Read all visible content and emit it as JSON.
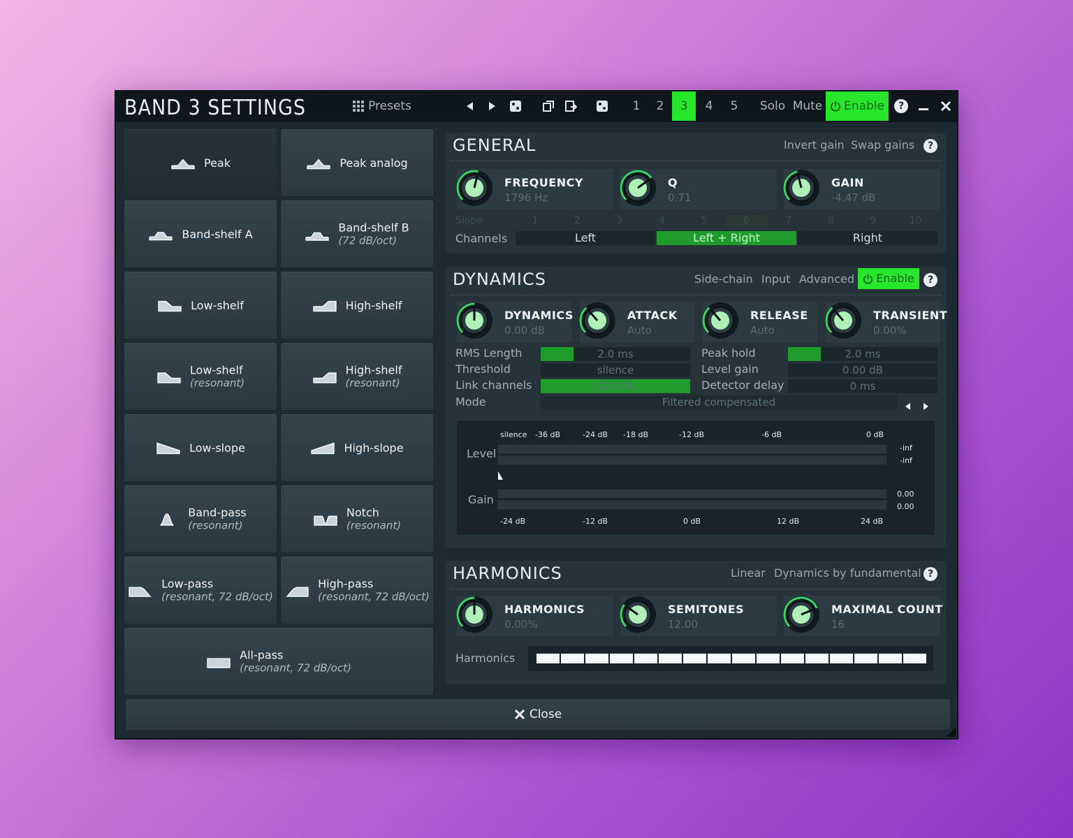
{
  "window": {
    "title": "BAND 3 SETTINGS",
    "presets_label": "Presets",
    "bands": [
      "1",
      "2",
      "3",
      "4",
      "5"
    ],
    "active_band": "3",
    "solo": "Solo",
    "mute": "Mute",
    "enable": "Enable",
    "accent_color": "#27e62b"
  },
  "filter_types": [
    {
      "label": "Peak",
      "sub": "",
      "icon": "peak-icon",
      "selected": true
    },
    {
      "label": "Peak analog",
      "sub": "",
      "icon": "peak-analog-icon"
    },
    {
      "label": "Band-shelf A",
      "sub": "",
      "icon": "band-shelf-icon"
    },
    {
      "label": "Band-shelf B",
      "sub": "(72 dB/oct)",
      "icon": "band-shelf-icon"
    },
    {
      "label": "Low-shelf",
      "sub": "",
      "icon": "low-shelf-icon"
    },
    {
      "label": "High-shelf",
      "sub": "",
      "icon": "high-shelf-icon"
    },
    {
      "label": "Low-shelf",
      "sub": "(resonant)",
      "icon": "low-shelf-icon"
    },
    {
      "label": "High-shelf",
      "sub": "(resonant)",
      "icon": "high-shelf-icon"
    },
    {
      "label": "Low-slope",
      "sub": "",
      "icon": "low-slope-icon"
    },
    {
      "label": "High-slope",
      "sub": "",
      "icon": "high-slope-icon"
    },
    {
      "label": "Band-pass",
      "sub": "(resonant)",
      "icon": "band-pass-icon"
    },
    {
      "label": "Notch",
      "sub": "(resonant)",
      "icon": "notch-icon"
    },
    {
      "label": "Low-pass",
      "sub": "(resonant, 72 dB/oct)",
      "icon": "low-pass-icon"
    },
    {
      "label": "High-pass",
      "sub": "(resonant, 72 dB/oct)",
      "icon": "high-pass-icon"
    },
    {
      "label": "All-pass",
      "sub": "(resonant, 72 dB/oct)",
      "icon": "all-pass-icon"
    }
  ],
  "general": {
    "title": "GENERAL",
    "invert_gain": "Invert gain",
    "swap_gains": "Swap gains",
    "knobs": [
      {
        "name": "FREQUENCY",
        "value": "1796 Hz",
        "level": 0.55
      },
      {
        "name": "Q",
        "value": "0.71",
        "level": 0.7
      },
      {
        "name": "GAIN",
        "value": "-4.47 dB",
        "level": 0.45
      }
    ],
    "slope_label": "Slope",
    "slope_values": [
      "1",
      "2",
      "3",
      "4",
      "5",
      "6",
      "7",
      "8",
      "9",
      "10"
    ],
    "channels_label": "Channels",
    "channels": [
      "Left",
      "Left + Right",
      "Right"
    ],
    "active_channel": "Left + Right"
  },
  "dynamics": {
    "title": "DYNAMICS",
    "side_chain": "Side-chain",
    "input": "Input",
    "advanced": "Advanced",
    "enable": "Enable",
    "knobs": [
      {
        "name": "DYNAMICS",
        "value": "0.00 dB",
        "level": 0.5
      },
      {
        "name": "ATTACK",
        "value": "Auto",
        "level": 0.35
      },
      {
        "name": "RELEASE",
        "value": "Auto",
        "level": 0.35
      },
      {
        "name": "TRANSIENT",
        "value": "0.00%",
        "level": 0.35
      }
    ],
    "rows_left": [
      {
        "label": "RMS Length",
        "value": "2.0 ms",
        "fill": 0.22
      },
      {
        "label": "Threshold",
        "value": "silence",
        "fill": 0
      },
      {
        "label": "Link channels",
        "value": "100.0%",
        "fill": 1.0
      }
    ],
    "rows_right": [
      {
        "label": "Peak hold",
        "value": "2.0 ms",
        "fill": 0.22
      },
      {
        "label": "Level gain",
        "value": "0.00 dB",
        "fill": 0
      },
      {
        "label": "Detector delay",
        "value": "0 ms",
        "fill": 0
      }
    ],
    "mode_label": "Mode",
    "mode_value": "Filtered compensated",
    "meter": {
      "level_label": "Level",
      "gain_label": "Gain",
      "top_scale": [
        "silence",
        "-36 dB",
        "-24 dB",
        "-18 dB",
        "-12 dB",
        "-6 dB",
        "0 dB"
      ],
      "bottom_scale": [
        "-24 dB",
        "-12 dB",
        "0 dB",
        "12 dB",
        "24 dB"
      ],
      "level_readouts": [
        "-inf",
        "-inf"
      ],
      "gain_readouts": [
        "0.00",
        "0.00"
      ]
    }
  },
  "harmonics": {
    "title": "HARMONICS",
    "linear": "Linear",
    "dyn_fund": "Dynamics by fundamental",
    "knobs": [
      {
        "name": "HARMONICS",
        "value": "0.00%",
        "level": 0.5
      },
      {
        "name": "SEMITONES",
        "value": "12.00",
        "level": 0.3
      },
      {
        "name": "MAXIMAL COUNT",
        "value": "16",
        "level": 0.75
      }
    ],
    "row_label": "Harmonics",
    "count": 16
  },
  "close_label": "Close"
}
